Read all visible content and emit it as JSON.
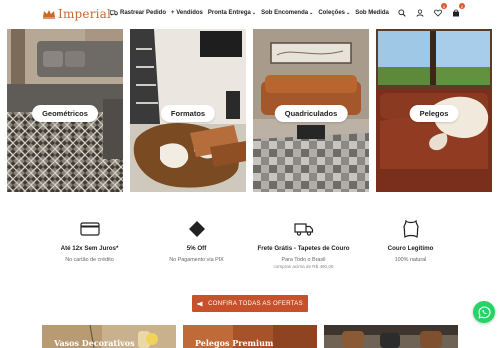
{
  "brand": {
    "name": "Imperial",
    "color": "#c8692e"
  },
  "nav": {
    "items": [
      {
        "label": "Rastrear Pedido",
        "icon": "truck-icon"
      },
      {
        "label": "+ Vendidos"
      },
      {
        "label": "Pronta Entrega",
        "dropdown": true
      },
      {
        "label": "Sob Encomenda",
        "dropdown": true
      },
      {
        "label": "Coleções",
        "dropdown": true
      },
      {
        "label": "Sob Medida"
      }
    ]
  },
  "header_icons": {
    "search": "search-icon",
    "account": "user-icon",
    "wishlist": {
      "icon": "heart-icon",
      "count": "0"
    },
    "cart": {
      "icon": "bag-icon",
      "count": "0"
    }
  },
  "categories": [
    {
      "label": "Geométricos"
    },
    {
      "label": "Formatos"
    },
    {
      "label": "Quadriculados"
    },
    {
      "label": "Pelegos"
    }
  ],
  "benefits": [
    {
      "icon": "credit-card-icon",
      "title": "Até 12x Sem Juros*",
      "subtitle": "No cartão de crédito",
      "note": ""
    },
    {
      "icon": "diamond-icon",
      "title": "5% Off",
      "subtitle": "No Pagamento via PIX",
      "note": ""
    },
    {
      "icon": "delivery-truck-icon",
      "title": "Frete Grátis - Tapetes de Couro",
      "subtitle": "Para Todo o Brasil",
      "note": "compras acima de R$ 490,00"
    },
    {
      "icon": "leather-hide-icon",
      "title": "Couro Legítimo",
      "subtitle": "100% natural",
      "note": ""
    }
  ],
  "cta": {
    "label": "CONFIRA TODAS AS OFERTAS",
    "color": "#c8502a"
  },
  "promos": [
    {
      "label": "Vasos Decorativos"
    },
    {
      "label": "Pelegos Premium"
    },
    {
      "label": ""
    }
  ],
  "whatsapp": {
    "icon": "whatsapp-icon",
    "color": "#25d366"
  }
}
